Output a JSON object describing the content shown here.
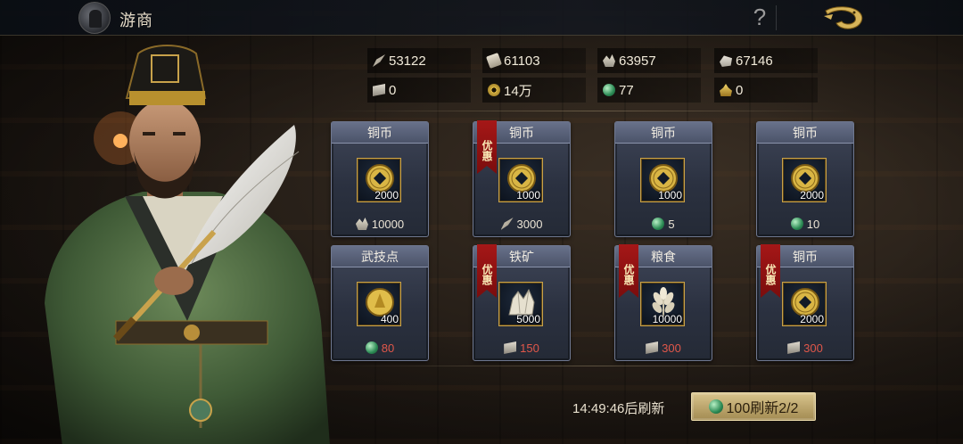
{
  "header": {
    "title": "游商"
  },
  "resources": [
    {
      "icon": "feather-icon",
      "value": "53122"
    },
    {
      "icon": "scroll-icon",
      "value": "61103"
    },
    {
      "icon": "ore-icon",
      "value": "63957"
    },
    {
      "icon": "stone-icon",
      "value": "67146"
    },
    {
      "icon": "ticket-icon",
      "value": "0"
    },
    {
      "icon": "coin-icon",
      "value": "14万"
    },
    {
      "icon": "jade-icon",
      "value": "77"
    },
    {
      "icon": "gold-icon",
      "value": "0"
    }
  ],
  "shop": {
    "items": [
      {
        "name": "铜币",
        "qty": "2000",
        "price": "10000",
        "price_icon": "ore-icon",
        "badge": "",
        "price_red": false
      },
      {
        "name": "铜币",
        "qty": "1000",
        "price": "3000",
        "price_icon": "feather-icon",
        "badge": "优惠",
        "price_red": false
      },
      {
        "name": "铜币",
        "qty": "1000",
        "price": "5",
        "price_icon": "jade-icon",
        "badge": "",
        "price_red": false
      },
      {
        "name": "铜币",
        "qty": "2000",
        "price": "10",
        "price_icon": "jade-icon",
        "badge": "",
        "price_red": false
      },
      {
        "name": "武技点",
        "qty": "400",
        "price": "80",
        "price_icon": "jade-icon",
        "badge": "",
        "price_red": true
      },
      {
        "name": "铁矿",
        "qty": "5000",
        "price": "150",
        "price_icon": "ticket-icon",
        "badge": "优惠",
        "price_red": true
      },
      {
        "name": "粮食",
        "qty": "10000",
        "price": "300",
        "price_icon": "ticket-icon",
        "badge": "优惠",
        "price_red": true
      },
      {
        "name": "铜币",
        "qty": "2000",
        "price": "300",
        "price_icon": "ticket-icon",
        "badge": "优惠",
        "price_red": true
      }
    ]
  },
  "footer": {
    "timer": "14:49:46后刷新",
    "refresh_label": "100刷新2/2"
  },
  "colors": {
    "price_red": "#e0574a",
    "badge_red": "#a51717",
    "gold_border": "#c8a24a"
  }
}
